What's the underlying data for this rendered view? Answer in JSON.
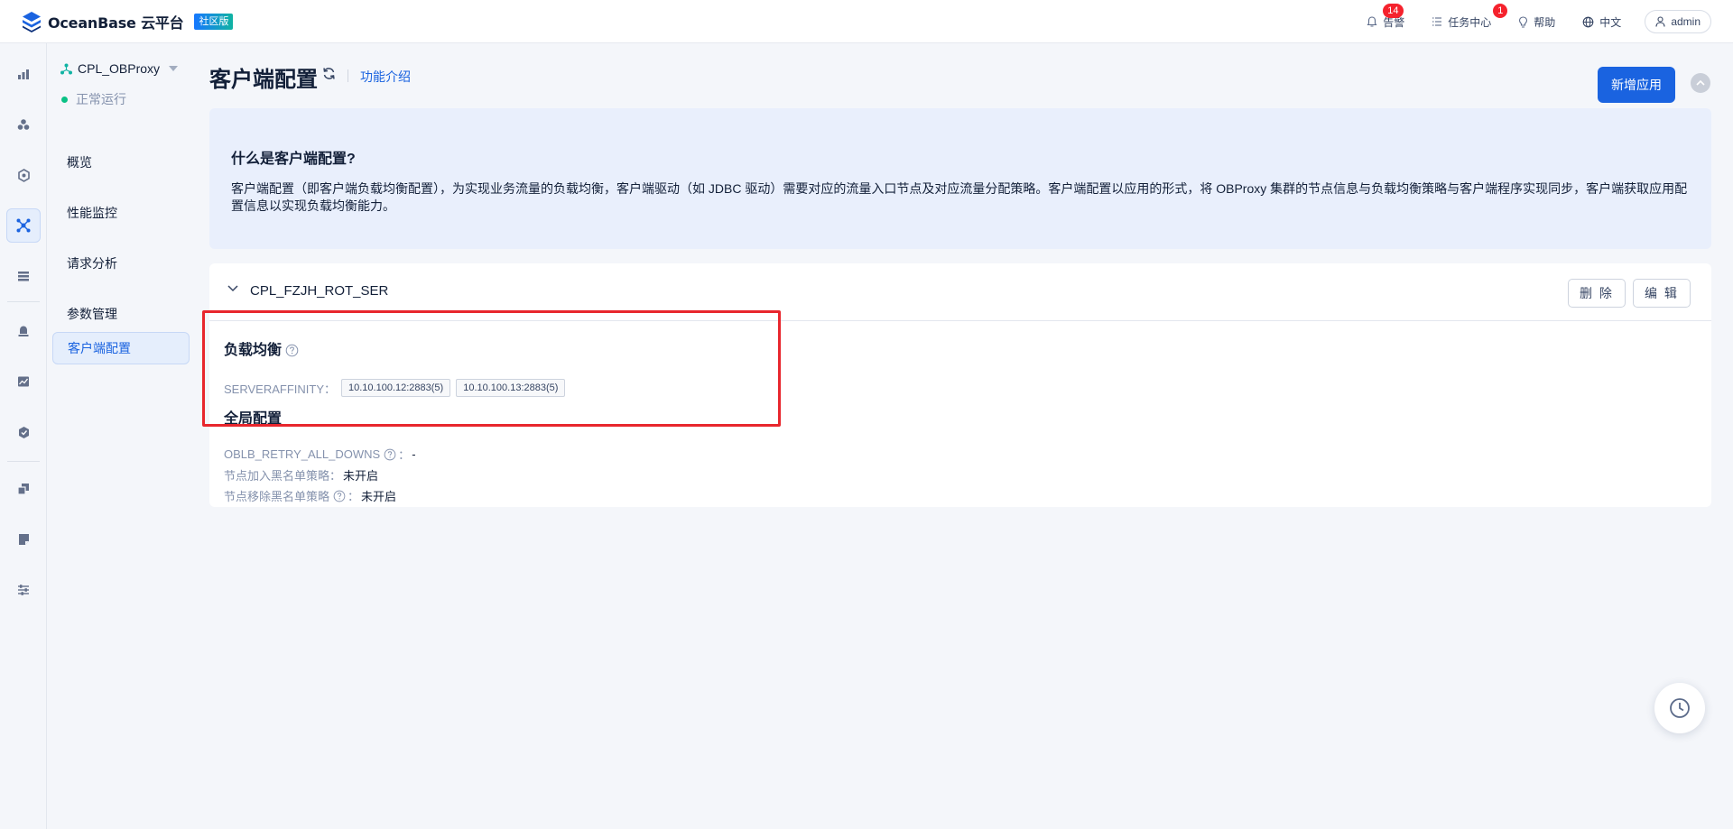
{
  "header": {
    "logo_text": "OceanBase 云平台",
    "edition_badge": "社区版",
    "alerts": {
      "label": "告警",
      "count": "14"
    },
    "tasks": {
      "label": "任务中心",
      "count": "1"
    },
    "help": "帮助",
    "language": "中文",
    "user": "admin"
  },
  "rail": {
    "icons": [
      "dashboard-icon",
      "cluster-icon",
      "tenant-icon",
      "obproxy-icon",
      "package-icon",
      "alert-icon",
      "monitor-icon",
      "security-icon",
      "backup-icon",
      "diagnosis-icon",
      "settings-icon"
    ],
    "active": "obproxy-icon"
  },
  "sidebar": {
    "cluster_name": "CPL_OBProxy",
    "status": "正常运行",
    "items": [
      {
        "label": "概览"
      },
      {
        "label": "性能监控"
      },
      {
        "label": "请求分析"
      },
      {
        "label": "参数管理"
      },
      {
        "label": "客户端配置",
        "active": true
      }
    ]
  },
  "main": {
    "title": "客户端配置",
    "intro_link": "功能介绍",
    "new_button": "新增应用",
    "info": {
      "title": "什么是客户端配置?",
      "text": "客户端配置（即客户端负载均衡配置），为实现业务流量的负载均衡，客户端驱动（如 JDBC 驱动）需要对应的流量入口节点及对应流量分配策略。客户端配置以应用的形式，将 OBProxy 集群的节点信息与负载均衡策略与客户端程序实现同步，客户端获取应用配置信息以实现负载均衡能力。"
    },
    "app": {
      "name": "CPL_FZJH_ROT_SER",
      "delete_button": "删 除",
      "edit_button": "编 辑",
      "load_balance": {
        "title": "负载均衡",
        "label": "SERVERAFFINITY：",
        "servers": [
          "10.10.100.12:2883(5)",
          "10.10.100.13:2883(5)"
        ]
      },
      "global_config": {
        "title": "全局配置",
        "retry": {
          "label": "OBLB_RETRY_ALL_DOWNS",
          "value": "-"
        },
        "blacklist_add": {
          "label": "节点加入黑名单策略：",
          "value": "未开启"
        },
        "blacklist_remove": {
          "label": "节点移除黑名单策略",
          "value": "未开启"
        }
      }
    }
  },
  "colors": {
    "primary": "#1a63e0",
    "highlight_box": "#e8262d",
    "status_ok": "#0ac185",
    "alert_badge": "#f5222d"
  }
}
